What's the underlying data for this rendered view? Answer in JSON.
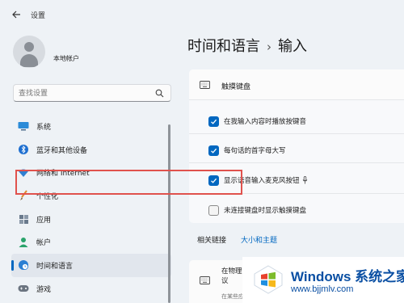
{
  "window": {
    "title": "设置"
  },
  "sidebar": {
    "user_name": "本地帐户",
    "search_placeholder": "查找设置",
    "items": [
      {
        "label": "系统",
        "icon": "monitor-icon"
      },
      {
        "label": "蓝牙和其他设备",
        "icon": "bluetooth-icon"
      },
      {
        "label": "网络和 Internet",
        "icon": "wifi-icon"
      },
      {
        "label": "个性化",
        "icon": "brush-icon"
      },
      {
        "label": "应用",
        "icon": "apps-icon"
      },
      {
        "label": "帐户",
        "icon": "person-icon"
      },
      {
        "label": "时间和语言",
        "icon": "globe-clock-icon",
        "active": true
      },
      {
        "label": "游戏",
        "icon": "gamepad-icon"
      }
    ]
  },
  "main": {
    "breadcrumb": {
      "parent": "时间和语言",
      "separator": "›",
      "current": "输入"
    },
    "touch_keyboard": {
      "title": "触摸键盘",
      "options": [
        {
          "label": "在我输入内容时播放按键音",
          "checked": true
        },
        {
          "label": "每句话的首字母大写",
          "checked": true
        },
        {
          "label": "显示语音输入麦克风按钮",
          "checked": true
        },
        {
          "label": "未连接键盘时显示触摸键盘",
          "checked": false
        }
      ]
    },
    "related": {
      "label": "相关链接",
      "link": "大小和主题"
    },
    "bottom_card": {
      "title": "在物理 议",
      "subtitle": "在某些应"
    }
  },
  "watermark": {
    "brand": "Windows 系统之家",
    "url": "www.bjjmlv.com"
  },
  "colors": {
    "accent": "#0067c0",
    "highlight_border": "#e0524d",
    "background": "#eef2f6"
  }
}
